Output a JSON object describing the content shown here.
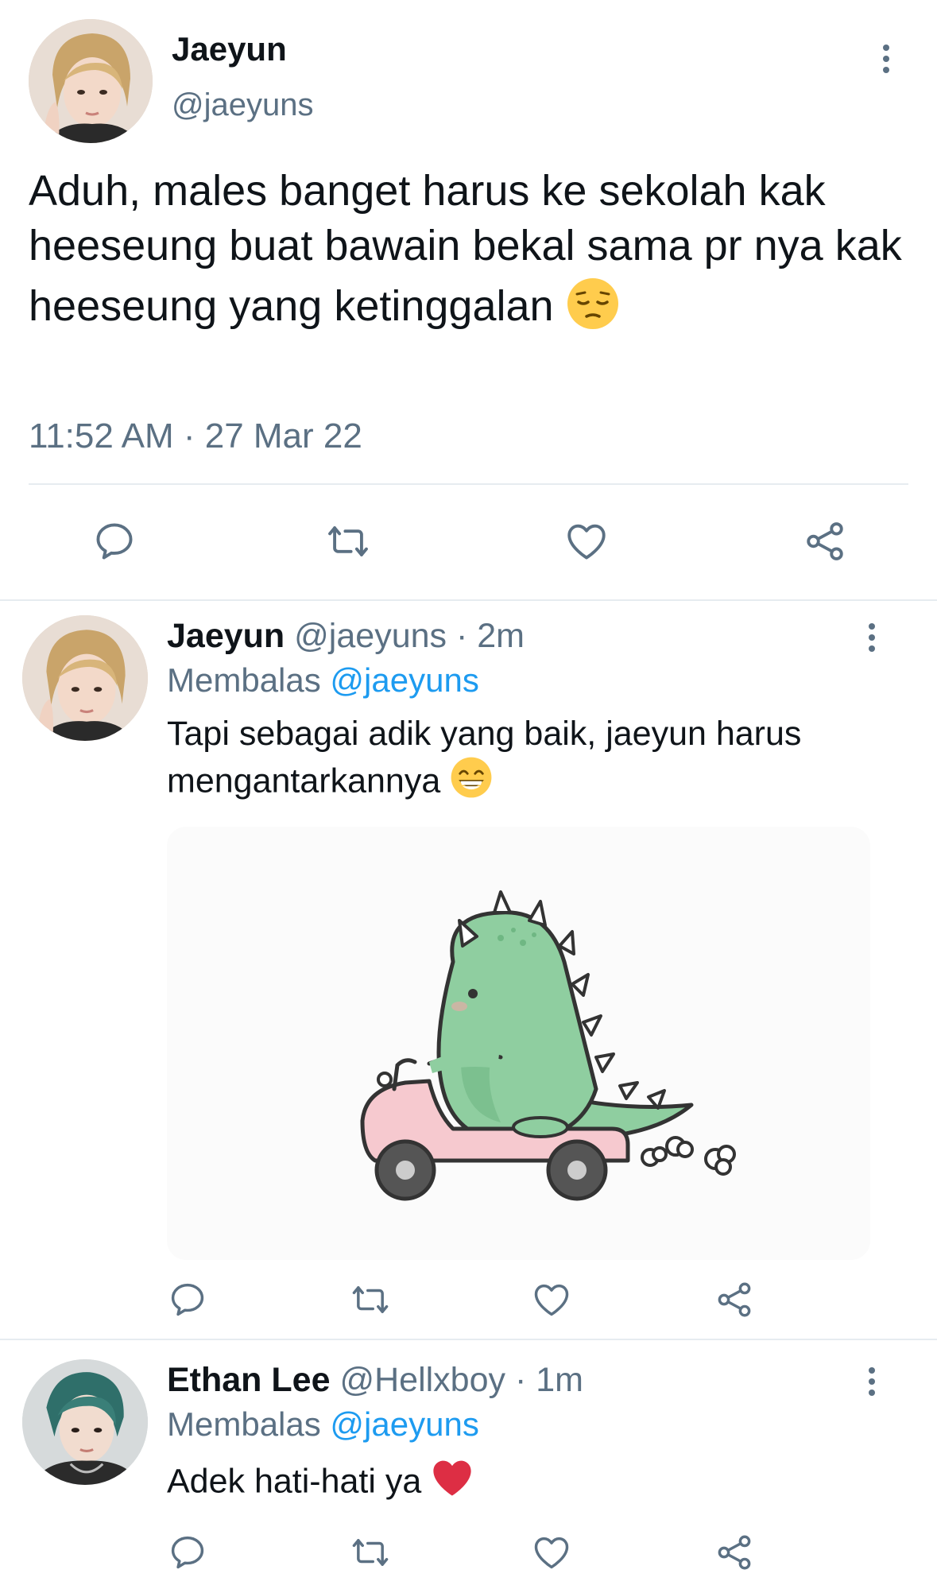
{
  "main_tweet": {
    "author_name": "Jaeyun",
    "author_handle": "@jaeyuns",
    "text": "Aduh, males banget harus ke sekolah kak heeseung buat bawain bekal sama pr nya kak heeseung yang ketinggalan",
    "emoji": "pensive-face",
    "timestamp": "11:52 AM · 27 Mar 22",
    "actions": [
      "reply-icon",
      "retweet-icon",
      "like-icon",
      "share-icon"
    ]
  },
  "replies": [
    {
      "author_name": "Jaeyun",
      "author_handle": "@jaeyuns",
      "time": "· 2m",
      "replying_prefix": "Membalas",
      "replying_to": "@jaeyuns",
      "text_line1": "Tapi sebagai adik yang baik, jaeyun harus",
      "text_line2": "mengantarkannya",
      "emoji": "grinning-face",
      "media": "green dinosaur riding a pink scooter"
    },
    {
      "author_name": "Ethan Lee",
      "author_handle": "@Hellxboy",
      "time": "· 1m",
      "replying_prefix": "Membalas",
      "replying_to": "@jaeyuns",
      "text": "Adek hati-hati ya",
      "emoji": "red-heart"
    }
  ],
  "colors": {
    "text": "#0f1419",
    "muted": "#5b7083",
    "link": "#1d9bf0",
    "divider": "#e6ecf0"
  }
}
